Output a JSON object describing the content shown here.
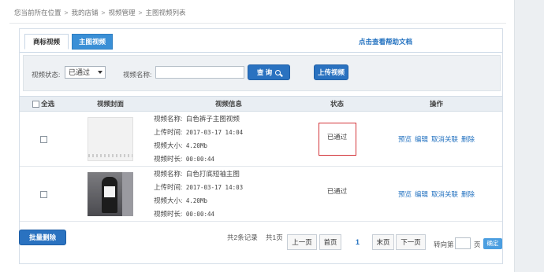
{
  "breadcrumb": [
    "您当前所在位置",
    "我的店铺",
    "视频管理",
    "主图视频列表"
  ],
  "tabs": [
    {
      "label": "商标视频",
      "active": false
    },
    {
      "label": "主图视频",
      "active": true
    }
  ],
  "help_link": "点击查看帮助文档",
  "filter": {
    "status_label": "视频状态:",
    "status_value": "已通过",
    "name_label": "视频名称:",
    "name_value": "",
    "search_button": "查 询",
    "upload_button": "上传视频"
  },
  "table": {
    "headers": {
      "select_all": "全选",
      "cover": "视频封面",
      "info": "视频信息",
      "status": "状态",
      "ops": "操作"
    },
    "rows": [
      {
        "name_label": "视频名称:",
        "name": "白色裤子主图视频",
        "upload_label": "上传时间:",
        "upload_time": "2017-03-17 14:04",
        "size_label": "视频大小:",
        "size": "4.20Mb",
        "duration_label": "视频时长:",
        "duration": "00:00:44",
        "status": "已通过",
        "ops": [
          "预览",
          "编辑",
          "取消关联",
          "删除"
        ]
      },
      {
        "name_label": "视频名称:",
        "name": "白色打底短袖主图",
        "upload_label": "上传时间:",
        "upload_time": "2017-03-17 14:03",
        "size_label": "视频大小:",
        "size": "4.20Mb",
        "duration_label": "视频时长:",
        "duration": "00:00:44",
        "status": "已通过",
        "ops": [
          "预览",
          "编辑",
          "取消关联",
          "删除"
        ]
      }
    ]
  },
  "bulk_delete": "批量删除",
  "pagination": {
    "total_records": "共2条记录",
    "total_pages": "共1页",
    "prev": "上一页",
    "first": "首页",
    "current": "1",
    "last": "末页",
    "next": "下一页",
    "goto_prefix": "转向第",
    "goto_suffix": "页",
    "confirm": "确定"
  },
  "colors": {
    "primary": "#2a72c0",
    "link": "#1f6fbf",
    "highlight": "#d3353a"
  }
}
